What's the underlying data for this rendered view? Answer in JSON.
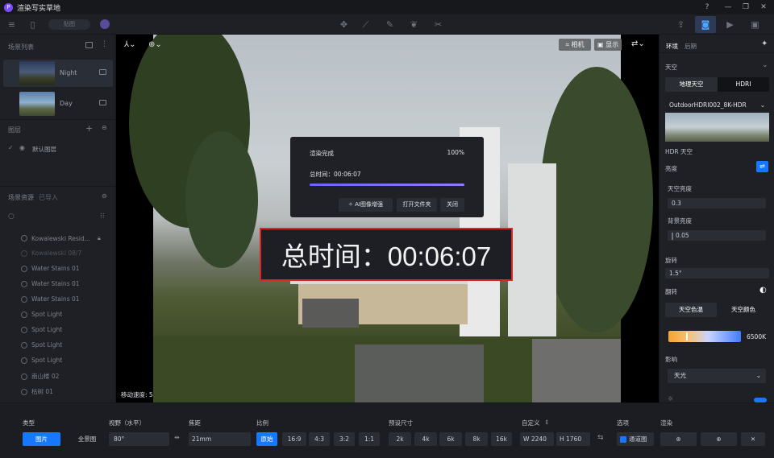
{
  "app": {
    "title": "渲染写实草地"
  },
  "toolbar": {
    "tag_text": "贴图"
  },
  "left": {
    "scene_list_title": "场景列表",
    "scenes": [
      {
        "label": "Night"
      },
      {
        "label": "Day"
      }
    ],
    "layers_title": "图层",
    "default_layer": "默认图层",
    "assets_title": "场景资源",
    "imported_tab": "已导入",
    "assets": [
      "Kowalewski Resid...",
      "Kowalewski 08/7",
      "Water Stains 01",
      "Water Stains 01",
      "Water Stains 01",
      "Spot Light",
      "Spot Light",
      "Spot Light",
      "Spot Light",
      "南山楼 02",
      "枯树 01"
    ],
    "move_speed": "移动速度: 5"
  },
  "viewport": {
    "camera_button": "相机",
    "display_button": "显示",
    "dialog": {
      "title": "渲染完成",
      "percent": "100%",
      "time_label": "总时间：00:06:07",
      "progress": 1.0,
      "ai_button": "AI图像增强",
      "open_folder_button": "打开文件夹",
      "close_button": "关闭"
    },
    "big_time": "总时间：00:06:07"
  },
  "right": {
    "tab_env": "环境",
    "tab_post": "后期",
    "sky_title": "天空",
    "sky_type_geo": "地理天空",
    "sky_type_hdri": "HDRI",
    "hdri_select": "OutdoorHDRI002_8K-HDR",
    "hdr_sky_label": "HDR 天空",
    "brightness_label": "亮度",
    "sky_brightness_label": "天空亮度",
    "sky_brightness_value": "0.3",
    "bg_brightness_label": "背景亮度",
    "bg_brightness_value": "0.05",
    "rotate_label": "旋转",
    "rotate_value": "1.5°",
    "flip_label": "翻转",
    "sky_temp_button": "天空色温",
    "sky_color_button": "天空颜色",
    "temp_value": "6500K",
    "influence_label": "影响",
    "influence_select": "天光",
    "slider_fraction": 0.24,
    "accent": "#1677ff"
  },
  "bottom": {
    "type_label": "类型",
    "type_image": "图片",
    "type_panorama": "全景图",
    "fov_label": "视野（水平）",
    "fov_value": "80°",
    "focal_label": "焦距",
    "focal_value": "21mm",
    "ratio_label": "比例",
    "ratios": [
      "原始",
      "16:9",
      "4:3",
      "3:2",
      "1:1"
    ],
    "preset_label": "预设尺寸",
    "presets": [
      "2k",
      "4k",
      "6k",
      "8k",
      "16k"
    ],
    "custom_label": "自定义",
    "width_prefix": "W",
    "width_value": "2240",
    "height_prefix": "H",
    "height_value": "1760",
    "options_label": "选项",
    "channel_label": "通道图",
    "render_label": "渲染"
  }
}
